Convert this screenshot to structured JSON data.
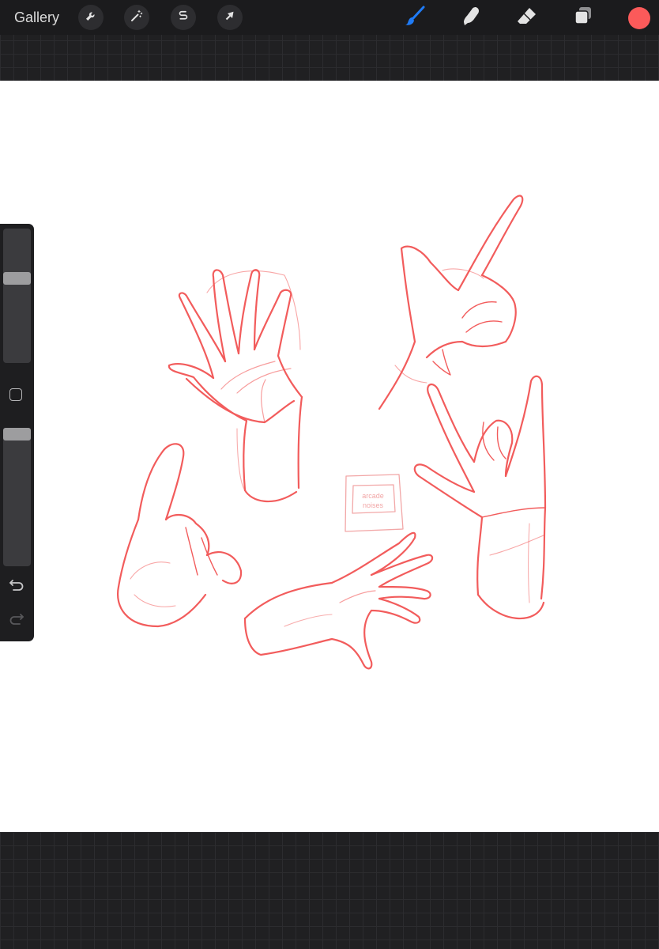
{
  "toolbar": {
    "gallery_label": "Gallery",
    "left_tools": [
      {
        "name": "actions",
        "icon": "wrench-icon"
      },
      {
        "name": "adjustments",
        "icon": "magic-wand-icon"
      },
      {
        "name": "selection",
        "icon": "selection-s-icon"
      },
      {
        "name": "transform",
        "icon": "arrow-cursor-icon"
      }
    ],
    "right_tools": [
      {
        "name": "brush",
        "icon": "brush-icon",
        "active": true
      },
      {
        "name": "smudge",
        "icon": "smudge-finger-icon",
        "active": false
      },
      {
        "name": "eraser",
        "icon": "eraser-icon",
        "active": false
      },
      {
        "name": "layers",
        "icon": "layers-icon",
        "active": false
      }
    ],
    "current_color": "#fb5a5a"
  },
  "sidebar": {
    "brush_size": 0.64,
    "brush_opacity": 1.0,
    "modify_icon": "square-icon",
    "undo_icon": "undo-arrow-icon",
    "redo_icon": "redo-arrow-icon"
  },
  "canvas": {
    "background": "#ffffff",
    "stroke_color": "#f25c5c",
    "watermark_lines": [
      "arcade",
      "noises"
    ]
  },
  "colors": {
    "active_tool": "#1f7bf6",
    "inactive_tool": "#e3e3e3",
    "toolbar_bg": "#1b1b1d"
  }
}
